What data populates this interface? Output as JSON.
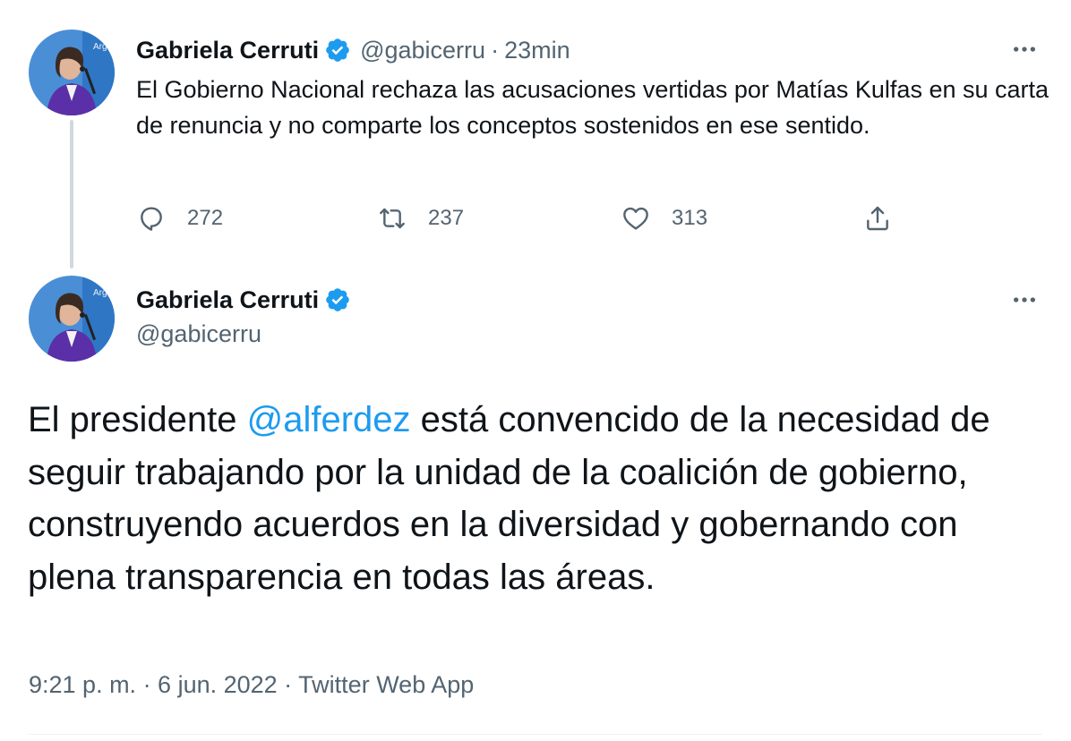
{
  "tweet1": {
    "author_name": "Gabriela Cerruti",
    "handle": "@gabicerru",
    "separator": "·",
    "time": "23min",
    "text": "El Gobierno Nacional rechaza las acusaciones vertidas por Matías Kulfas en su carta de renuncia y no comparte los conceptos  sostenidos en ese sentido.",
    "replies": "272",
    "retweets": "237",
    "likes": "313"
  },
  "tweet2": {
    "author_name": "Gabriela Cerruti",
    "handle": "@gabicerru",
    "text_before": "El presidente ",
    "mention": "@alferdez",
    "text_after": " está convencido de la necesidad de seguir trabajando por la unidad de la coalición de gobierno, construyendo acuerdos en la diversidad y gobernando con plena transparencia en todas las áreas.",
    "meta": "9:21 p. m. · 6 jun. 2022 · Twitter Web App"
  },
  "colors": {
    "accent": "#1d9bf0",
    "text_primary": "#0f1419",
    "text_secondary": "#536471",
    "thread_line": "#cfd9de"
  },
  "icons": {
    "verified": "verified-badge-icon",
    "more": "more-options-icon",
    "reply": "reply-icon",
    "retweet": "retweet-icon",
    "like": "heart-icon",
    "share": "share-icon"
  }
}
